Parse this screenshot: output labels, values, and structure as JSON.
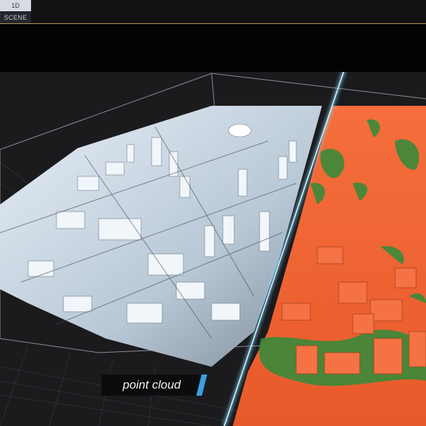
{
  "toolbar": {
    "tabs": [
      {
        "label": "1D"
      },
      {
        "label": "SCENE"
      }
    ]
  },
  "viewer": {
    "caption": "point cloud",
    "colors": {
      "background": "#1b1b1d",
      "grey_cloud": "#c8d4e0",
      "colored_cloud_buildings": "#f26a3a",
      "colored_cloud_vegetation": "#3a8a3a",
      "split_line": "#7fd8ff",
      "caption_accent": "#3aa0e0"
    }
  }
}
